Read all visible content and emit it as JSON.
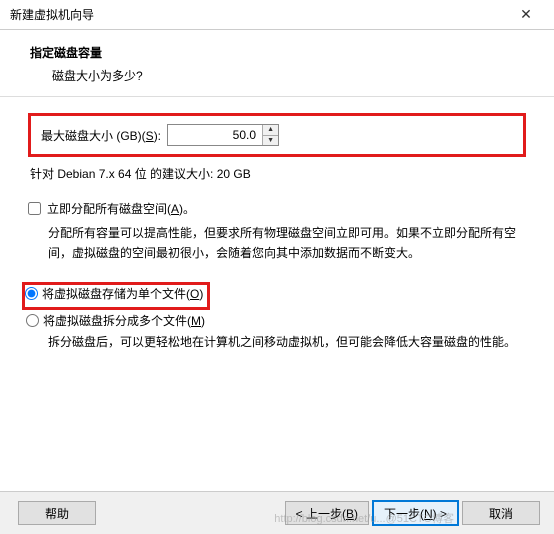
{
  "window": {
    "title": "新建虚拟机向导"
  },
  "header": {
    "title": "指定磁盘容量",
    "subtitle": "磁盘大小为多少?"
  },
  "disk": {
    "size_label_pre": "最大磁盘大小 (GB)(",
    "size_label_key": "S",
    "size_label_post": "):",
    "size_value": "50.0",
    "recommend": "针对 Debian 7.x 64 位 的建议大小: 20 GB"
  },
  "allocate": {
    "label_pre": "立即分配所有磁盘空间(",
    "label_key": "A",
    "label_post": ")。",
    "desc": "分配所有容量可以提高性能，但要求所有物理磁盘空间立即可用。如果不立即分配所有空间，虚拟磁盘的空间最初很小，会随着您向其中添加数据而不断变大。"
  },
  "store": {
    "single_pre": "将虚拟磁盘存储为单个文件(",
    "single_key": "O",
    "single_post": ")",
    "split_pre": "将虚拟磁盘拆分成多个文件(",
    "split_key": "M",
    "split_post": ")",
    "desc": "拆分磁盘后，可以更轻松地在计算机之间移动虚拟机，但可能会降低大容量磁盘的性能。"
  },
  "buttons": {
    "help": "帮助",
    "back_pre": "< 上一步(",
    "back_key": "B",
    "back_post": ")",
    "next_pre": "下一步(",
    "next_key": "N",
    "next_post": ") >",
    "cancel": "取消"
  },
  "watermark": "http://blog.csdn.net/u...@51CTO博客"
}
